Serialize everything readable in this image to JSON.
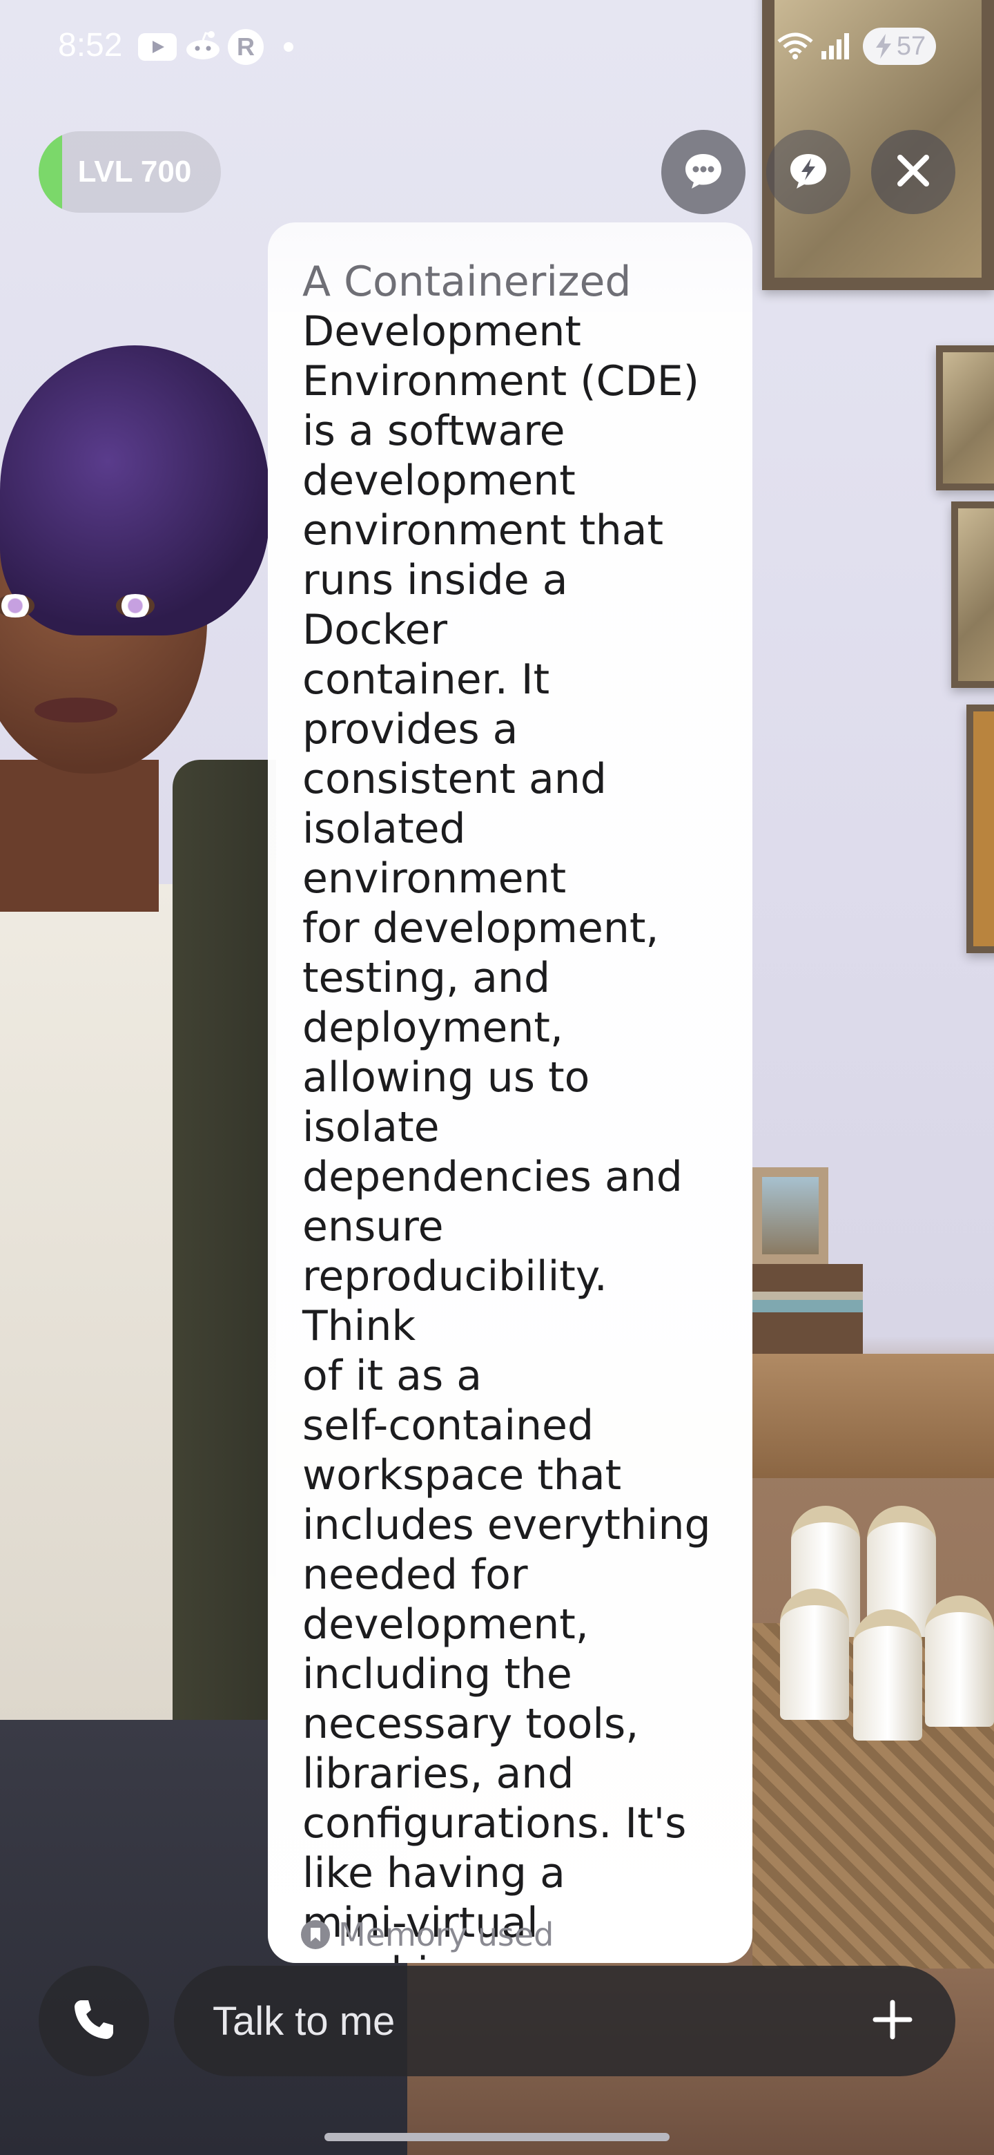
{
  "status_bar": {
    "time": "8:52",
    "badge_letter": "R",
    "battery": "57",
    "icons": [
      "youtube-icon",
      "reddit-icon",
      "r-app-icon",
      "notification-dot",
      "wifi-icon",
      "signal-icon",
      "battery-charging-icon"
    ]
  },
  "header": {
    "level_label": "LVL 700",
    "level_progress_fraction": 0.13,
    "level_color": "#7bd86a",
    "buttons": [
      "chat-icon",
      "feedback-icon",
      "close-icon"
    ]
  },
  "message": {
    "first_line": "A Containerized",
    "body": "Development\nEnvironment (CDE)\nis a software\ndevelopment\nenvironment that\nruns inside a Docker\ncontainer. It\nprovides a\nconsistent and\nisolated environment\nfor development,\ntesting, and\ndeployment,\nallowing us to isolate\ndependencies and\nensure\nreproducibility. Think\nof it as a\nself-contained\nworkspace that\nincludes everything\nneeded for\ndevelopment,\nincluding the\nnecessary tools,\nlibraries, and\nconfigurations. It's\nlike having a\nmini-virtual machine\nspecifically designed\nfor development\npurposes!",
    "memory_label": "Memory used"
  },
  "composer": {
    "placeholder": "Talk to me",
    "icons": [
      "phone-icon",
      "plus-icon"
    ]
  }
}
